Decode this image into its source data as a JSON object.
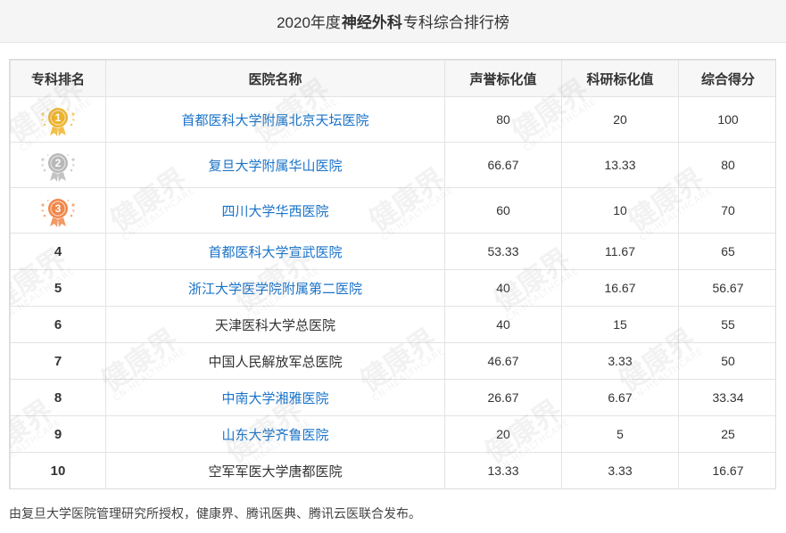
{
  "title": {
    "prefix": "2020年度",
    "highlight": "神经外科",
    "suffix": "专科综合排行榜"
  },
  "table": {
    "headers": [
      "专科排名",
      "医院名称",
      "声誉标化值",
      "科研标化值",
      "综合得分"
    ],
    "rows": [
      {
        "rank": "1",
        "medal": "gold",
        "name": "首都医科大学附属北京天坛医院",
        "link": true,
        "reputation": "80",
        "research": "20",
        "total": "100"
      },
      {
        "rank": "2",
        "medal": "silver",
        "name": "复旦大学附属华山医院",
        "link": true,
        "reputation": "66.67",
        "research": "13.33",
        "total": "80"
      },
      {
        "rank": "3",
        "medal": "bronze",
        "name": "四川大学华西医院",
        "link": true,
        "reputation": "60",
        "research": "10",
        "total": "70"
      },
      {
        "rank": "4",
        "medal": "",
        "name": "首都医科大学宣武医院",
        "link": true,
        "reputation": "53.33",
        "research": "11.67",
        "total": "65"
      },
      {
        "rank": "5",
        "medal": "",
        "name": "浙江大学医学院附属第二医院",
        "link": true,
        "reputation": "40",
        "research": "16.67",
        "total": "56.67"
      },
      {
        "rank": "6",
        "medal": "",
        "name": "天津医科大学总医院",
        "link": false,
        "reputation": "40",
        "research": "15",
        "total": "55"
      },
      {
        "rank": "7",
        "medal": "",
        "name": "中国人民解放军总医院",
        "link": false,
        "reputation": "46.67",
        "research": "3.33",
        "total": "50"
      },
      {
        "rank": "8",
        "medal": "",
        "name": "中南大学湘雅医院",
        "link": true,
        "reputation": "26.67",
        "research": "6.67",
        "total": "33.34"
      },
      {
        "rank": "9",
        "medal": "",
        "name": "山东大学齐鲁医院",
        "link": true,
        "reputation": "20",
        "research": "5",
        "total": "25"
      },
      {
        "rank": "10",
        "medal": "",
        "name": "空军军医大学唐都医院",
        "link": false,
        "reputation": "13.33",
        "research": "3.33",
        "total": "16.67"
      }
    ]
  },
  "watermark": {
    "text": "健康界",
    "sub": "CN-HEALTHCARE"
  },
  "footer": "由复旦大学医院管理研究所授权，健康界、腾讯医典、腾讯云医联合发布。",
  "colors": {
    "link": "#1a73c8",
    "gold": "#f0b429",
    "silver": "#b8b8b8",
    "bronze": "#f0874a"
  }
}
